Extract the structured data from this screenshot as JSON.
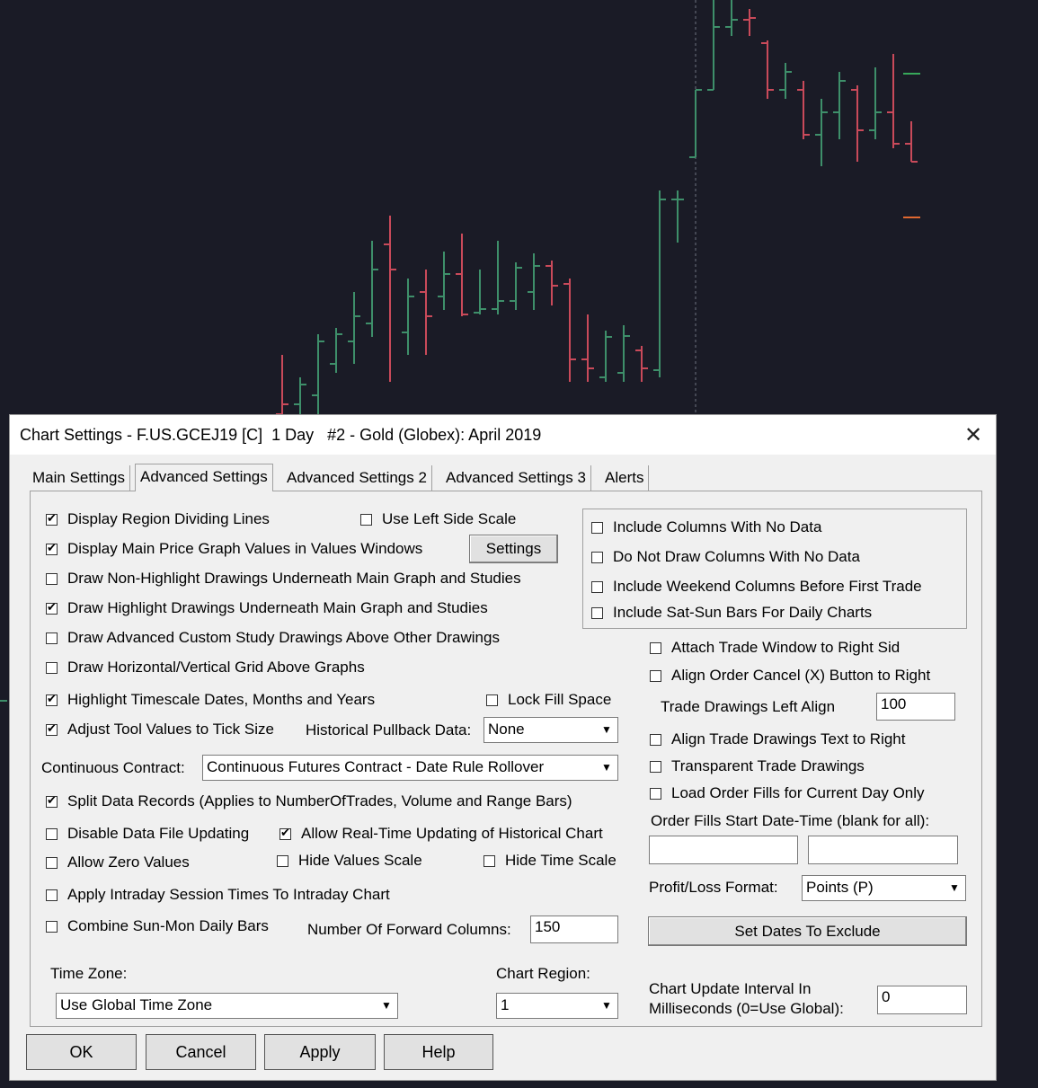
{
  "chart": {
    "bar_colors": {
      "up": "#3e8f6a",
      "down": "#c94a5a",
      "cursor_line": "#6f7380",
      "background": "#1a1b26"
    },
    "marker_colors": {
      "green": "#37a85a",
      "orange": "#e06830"
    }
  },
  "dialog": {
    "title": "Chart Settings - F.US.GCEJ19 [C]  1 Day   #2 - Gold (Globex): April 2019",
    "close_glyph": "✕",
    "tabs": [
      {
        "label": "Main Settings",
        "active": false
      },
      {
        "label": "Advanced Settings",
        "active": true
      },
      {
        "label": "Advanced Settings 2",
        "active": false
      },
      {
        "label": "Advanced Settings 3",
        "active": false
      },
      {
        "label": "Alerts",
        "active": false
      }
    ],
    "left": {
      "display_region_dividing_lines": "Display Region Dividing Lines",
      "use_left_side_scale": "Use Left Side Scale",
      "display_main_price_values": "Display Main Price Graph Values in Values Windows",
      "settings_button": "Settings",
      "draw_non_highlight_underneath": "Draw Non-Highlight Drawings Underneath Main Graph and Studies",
      "draw_highlight_underneath": "Draw Highlight Drawings Underneath Main Graph and Studies",
      "draw_advanced_custom_above": "Draw Advanced Custom Study Drawings Above Other Drawings",
      "draw_grid_above": "Draw Horizontal/Vertical Grid Above Graphs",
      "highlight_timescale": "Highlight Timescale Dates, Months and Years",
      "lock_fill_space": "Lock Fill Space",
      "adjust_tool_values": "Adjust Tool Values to Tick Size",
      "historical_pullback_label": "Historical Pullback Data:",
      "historical_pullback_value": "None",
      "continuous_contract_label": "Continuous Contract:",
      "continuous_contract_value": "Continuous Futures Contract - Date Rule Rollover",
      "split_data_records": "Split Data Records (Applies to NumberOfTrades, Volume and Range Bars)",
      "disable_data_file_updating": "Disable Data File Updating",
      "allow_realtime_updating": "Allow Real-Time Updating of Historical Chart",
      "allow_zero_values": "Allow Zero Values",
      "hide_values_scale": "Hide Values Scale",
      "hide_time_scale": "Hide Time Scale",
      "apply_intraday_session": "Apply Intraday Session Times To Intraday Chart",
      "combine_sun_mon": "Combine Sun-Mon Daily Bars",
      "forward_columns_label": "Number Of Forward Columns:",
      "forward_columns_value": "150",
      "time_zone_label": "Time Zone:",
      "time_zone_value": "Use Global Time Zone",
      "chart_region_label": "Chart Region:",
      "chart_region_value": "1"
    },
    "right": {
      "include_columns_no_data": "Include Columns With No Data",
      "do_not_draw_columns": "Do Not Draw Columns With No Data",
      "include_weekend_columns": "Include Weekend Columns Before First Trade",
      "include_sat_sun": "Include Sat-Sun Bars For Daily Charts",
      "attach_trade_window": "Attach Trade Window to Right Sid",
      "align_order_cancel": "Align Order Cancel (X) Button to Right",
      "trade_drawings_left_align_label": "Trade Drawings Left Align",
      "trade_drawings_left_align_value": "100",
      "align_trade_drawings_text": "Align Trade Drawings Text to Right",
      "transparent_trade_drawings": "Transparent Trade Drawings",
      "load_order_fills": "Load Order Fills for Current Day Only",
      "order_fills_start_label": "Order Fills Start Date-Time (blank for all):",
      "order_fills_start_value_1": "",
      "order_fills_start_value_2": "",
      "profit_loss_label": "Profit/Loss Format:",
      "profit_loss_value": "Points (P)",
      "set_dates_button": "Set Dates To Exclude",
      "chart_update_label_line1": "Chart Update Interval In",
      "chart_update_label_line2": "Milliseconds (0=Use Global):",
      "chart_update_value": "0"
    },
    "buttons": {
      "ok": "OK",
      "cancel": "Cancel",
      "apply": "Apply",
      "help": "Help"
    }
  }
}
